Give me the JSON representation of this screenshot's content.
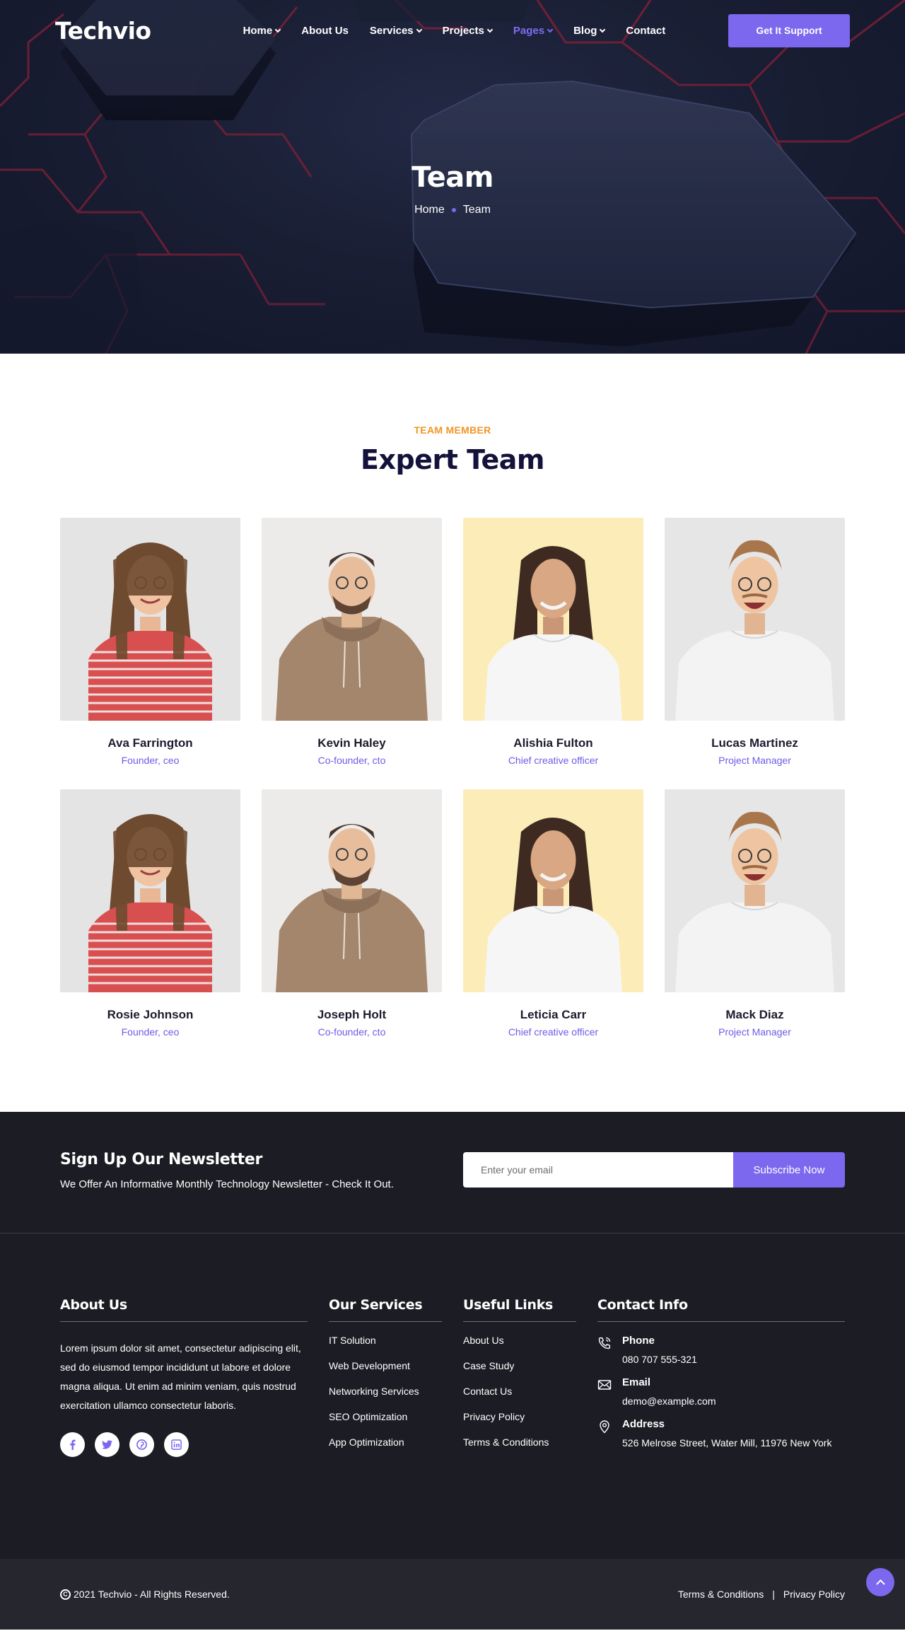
{
  "nav": {
    "logo": "Techvio",
    "items": [
      {
        "label": "Home",
        "dropdown": true,
        "active": false
      },
      {
        "label": "About Us",
        "dropdown": false,
        "active": false
      },
      {
        "label": "Services",
        "dropdown": true,
        "active": false
      },
      {
        "label": "Projects",
        "dropdown": true,
        "active": false
      },
      {
        "label": "Pages",
        "dropdown": true,
        "active": true
      },
      {
        "label": "Blog",
        "dropdown": true,
        "active": false
      },
      {
        "label": "Contact",
        "dropdown": false,
        "active": false
      }
    ],
    "cta": "Get It Support"
  },
  "hero": {
    "title": "Team",
    "breadcrumb": {
      "home": "Home",
      "current": "Team"
    }
  },
  "team": {
    "subtitle": "TEAM MEMBER",
    "title": "Expert Team",
    "members": [
      {
        "name": "Ava Farrington",
        "role": "Founder, ceo"
      },
      {
        "name": "Kevin Haley",
        "role": "Co-founder, cto"
      },
      {
        "name": "Alishia Fulton",
        "role": "Chief creative officer"
      },
      {
        "name": "Lucas Martinez",
        "role": "Project Manager"
      },
      {
        "name": "Rosie Johnson",
        "role": "Founder, ceo"
      },
      {
        "name": "Joseph Holt",
        "role": "Co-founder, cto"
      },
      {
        "name": "Leticia Carr",
        "role": "Chief creative officer"
      },
      {
        "name": "Mack Diaz",
        "role": "Project Manager"
      }
    ]
  },
  "newsletter": {
    "title": "Sign Up Our Newsletter",
    "description": "We Offer An Informative Monthly Technology Newsletter - Check It Out.",
    "placeholder": "Enter your email",
    "button": "Subscribe Now"
  },
  "footer": {
    "about": {
      "title": "About Us",
      "text": "Lorem ipsum dolor sit amet, consectetur adipiscing elit, sed do eiusmod tempor incididunt ut labore et dolore magna aliqua. Ut enim ad minim veniam, quis nostrud exercitation ullamco consectetur laboris.",
      "socials": [
        "facebook-icon",
        "twitter-icon",
        "pinterest-icon",
        "linkedin-icon"
      ]
    },
    "services": {
      "title": "Our Services",
      "items": [
        "IT Solution",
        "Web Development",
        "Networking Services",
        "SEO Optimization",
        "App Optimization"
      ]
    },
    "links": {
      "title": "Useful Links",
      "items": [
        "About Us",
        "Case Study",
        "Contact Us",
        "Privacy Policy",
        "Terms & Conditions"
      ]
    },
    "contact": {
      "title": "Contact Info",
      "phone_label": "Phone",
      "phone": "080 707 555-321",
      "email_label": "Email",
      "email": "demo@example.com",
      "address_label": "Address",
      "address": "526 Melrose Street, Water Mill, 11976 New York"
    }
  },
  "bottom": {
    "copyright": "2021 Techvio - All Rights Reserved.",
    "terms": "Terms & Conditions",
    "separator": "|",
    "privacy": "Privacy Policy"
  },
  "colors": {
    "accent": "#7b68ee",
    "subtitle": "#f29423",
    "heading": "#14123a",
    "footer_bg": "#1c1d24",
    "bottom_bg": "#25262e"
  }
}
